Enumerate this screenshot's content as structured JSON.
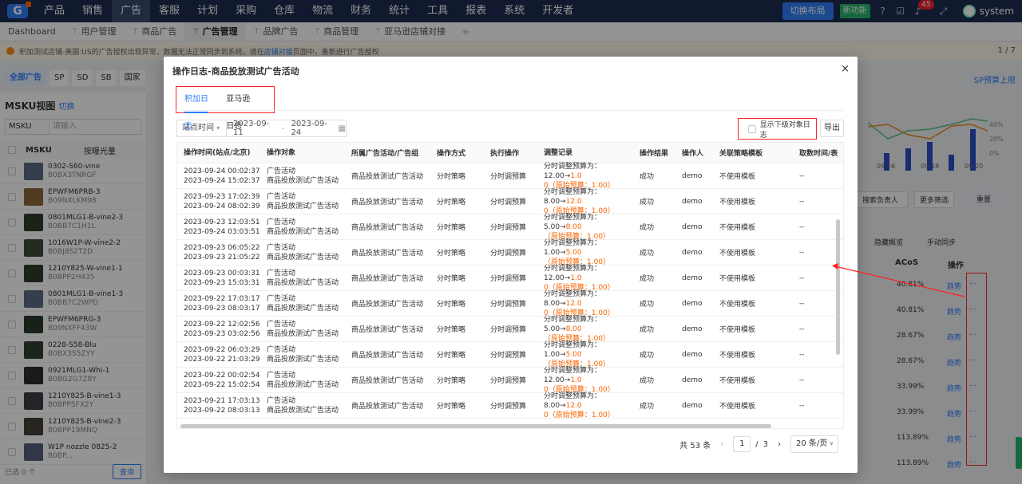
{
  "topnav": {
    "logo": "G",
    "menu": [
      "产品",
      "销售",
      "广告",
      "客服",
      "计划",
      "采购",
      "仓库",
      "物流",
      "财务",
      "统计",
      "工具",
      "报表",
      "系统",
      "开发者"
    ],
    "active_menu": "广告",
    "layout_btn": "切换布局",
    "new_feature": "新功能",
    "badge_count": "45",
    "user": "system"
  },
  "tabs": [
    {
      "label": "Dashboard",
      "pin": false,
      "active": false
    },
    {
      "label": "用户管理",
      "pin": true,
      "active": false
    },
    {
      "label": "商品广告",
      "pin": true,
      "active": false
    },
    {
      "label": "广告管理",
      "pin": true,
      "active": true
    },
    {
      "label": "品牌广告",
      "pin": true,
      "active": false
    },
    {
      "label": "商品管理",
      "pin": true,
      "active": false
    },
    {
      "label": "亚马逊店铺对接",
      "pin": true,
      "active": false
    }
  ],
  "tab_plus": "+",
  "notice": {
    "text": "积加测试店铺-美国:US的广告授权出现异常，数据无法正常同步到系统，请在",
    "link": "店铺对接",
    "tail": "页面中，重新进行广告授权"
  },
  "page_indicator": "1 / 7",
  "filters": [
    "全部广告",
    "SP",
    "SD",
    "SB",
    "国家"
  ],
  "sp_budget": "SP预算上限",
  "left_panel": {
    "title": "MSKU视图",
    "switch": "切换",
    "search_select": "MSKU",
    "search_placeholder": "请输入",
    "col_msku": "MSKU",
    "col_sort": "按曝光量",
    "items": [
      {
        "sku": "0302-S60-vine",
        "asin": "B0BX3TNRGF"
      },
      {
        "sku": "EPWFM6PRB-3",
        "asin": "B09NXLKM98"
      },
      {
        "sku": "0801MLG1-B-vine2-3",
        "asin": "B0BB7C1H1L"
      },
      {
        "sku": "1016W1P-W-vine2-2",
        "asin": "B0BJ8S2T2D"
      },
      {
        "sku": "1210Y825-W-vine1-1",
        "asin": "B0BPP2H435"
      },
      {
        "sku": "0801MLG1-B-vine1-3",
        "asin": "B0BB7C2WPD"
      },
      {
        "sku": "EPWFM6PRG-3",
        "asin": "B09NXFF43W"
      },
      {
        "sku": "0228-S58-Blu",
        "asin": "B0BX3S5ZYY"
      },
      {
        "sku": "0921MLG1-Whi-1",
        "asin": "B0BG2G7Z8Y"
      },
      {
        "sku": "1210Y825-B-vine1-3",
        "asin": "B0BPP5FX2Y"
      },
      {
        "sku": "1210Y825-B-vine2-3",
        "asin": "B0BPP19MNQ"
      },
      {
        "sku": "W1P nozzle 0825-2",
        "asin": "B0BP..."
      }
    ],
    "selected": "已选 0 个",
    "query_btn": "查询"
  },
  "right_bg": {
    "axis": [
      "40%",
      "20%",
      "0%"
    ],
    "xlabels": [
      "09-16",
      "09-18",
      "09-20"
    ],
    "filter_label": "搜索负责人",
    "more_filter": "更多筛选",
    "reset": "重置",
    "hide_overview": "隐藏概览",
    "manual_sync": "手动同步",
    "col_acos": "ACoS",
    "col_op": "操作",
    "rows": [
      {
        "acos": "40.81%",
        "trend": "趋势"
      },
      {
        "acos": "40.81%",
        "trend": "趋势"
      },
      {
        "acos": "28.67%",
        "trend": "趋势"
      },
      {
        "acos": "28.67%",
        "trend": "趋势"
      },
      {
        "acos": "33.99%",
        "trend": "趋势"
      },
      {
        "acos": "33.99%",
        "trend": "趋势"
      },
      {
        "acos": "113.89%",
        "trend": "趋势"
      },
      {
        "acos": "113.89%",
        "trend": "趋势"
      }
    ]
  },
  "modal": {
    "title": "操作日志-商品投放测试广告活动",
    "close": "×",
    "tabs": [
      "积加日志",
      "亚马逊日志"
    ],
    "active_tab": "积加日志",
    "date_type": "站点时间",
    "date_start": "2023-09-11",
    "date_sep": "-",
    "date_end": "2023-09-24",
    "show_sub_log": "显示下级对象日志",
    "export": "导出",
    "columns": [
      "操作时间(站点/北京)",
      "操作对象",
      "所属广告活动/广告组",
      "操作方式",
      "执行操作",
      "调整记录",
      "操作结果",
      "操作人",
      "关联策略模板",
      "取数时间/表"
    ],
    "rows": [
      {
        "t1": "2023-09-24 00:02:37",
        "t2": "2023-09-24 15:02:37",
        "obj1": "广告活动",
        "obj2": "商品投放测试广告活动",
        "camp": "商品投放测试广告活动",
        "method": "分时策略",
        "action": "分时调预算",
        "adj1": "分时调整预算为：12.00→",
        "adj1o": "1.0",
        "adj2": "0（原始预算：1.00）",
        "result": "成功",
        "user": "demo",
        "tpl": "不使用模板",
        "fetch": "--"
      },
      {
        "t1": "2023-09-23 17:02:39",
        "t2": "2023-09-24 08:02:39",
        "obj1": "广告活动",
        "obj2": "商品投放测试广告活动",
        "camp": "商品投放测试广告活动",
        "method": "分时策略",
        "action": "分时调预算",
        "adj1": "分时调整预算为：8.00→",
        "adj1o": "12.0",
        "adj2": "0（原始预算：1.00）",
        "result": "成功",
        "user": "demo",
        "tpl": "不使用模板",
        "fetch": "--"
      },
      {
        "t1": "2023-09-23 12:03:51",
        "t2": "2023-09-24 03:03:51",
        "obj1": "广告活动",
        "obj2": "商品投放测试广告活动",
        "camp": "商品投放测试广告活动",
        "method": "分时策略",
        "action": "分时调预算",
        "adj1": "分时调整预算为：5.00→",
        "adj1o": "8.00",
        "adj2": "（原始预算：1.00）",
        "result": "成功",
        "user": "demo",
        "tpl": "不使用模板",
        "fetch": "--"
      },
      {
        "t1": "2023-09-23 06:05:22",
        "t2": "2023-09-23 21:05:22",
        "obj1": "广告活动",
        "obj2": "商品投放测试广告活动",
        "camp": "商品投放测试广告活动",
        "method": "分时策略",
        "action": "分时调预算",
        "adj1": "分时调整预算为：1.00→",
        "adj1o": "5.00",
        "adj2": "（原始预算：1.00）",
        "result": "成功",
        "user": "demo",
        "tpl": "不使用模板",
        "fetch": "--"
      },
      {
        "t1": "2023-09-23 00:03:31",
        "t2": "2023-09-23 15:03:31",
        "obj1": "广告活动",
        "obj2": "商品投放测试广告活动",
        "camp": "商品投放测试广告活动",
        "method": "分时策略",
        "action": "分时调预算",
        "adj1": "分时调整预算为：12.00→",
        "adj1o": "1.0",
        "adj2": "0（原始预算：1.00）",
        "result": "成功",
        "user": "demo",
        "tpl": "不使用模板",
        "fetch": "--"
      },
      {
        "t1": "2023-09-22 17:03:17",
        "t2": "2023-09-23 08:03:17",
        "obj1": "广告活动",
        "obj2": "商品投放测试广告活动",
        "camp": "商品投放测试广告活动",
        "method": "分时策略",
        "action": "分时调预算",
        "adj1": "分时调整预算为：8.00→",
        "adj1o": "12.0",
        "adj2": "0（原始预算：1.00）",
        "result": "成功",
        "user": "demo",
        "tpl": "不使用模板",
        "fetch": "--"
      },
      {
        "t1": "2023-09-22 12:02:56",
        "t2": "2023-09-23 03:02:56",
        "obj1": "广告活动",
        "obj2": "商品投放测试广告活动",
        "camp": "商品投放测试广告活动",
        "method": "分时策略",
        "action": "分时调预算",
        "adj1": "分时调整预算为：5.00→",
        "adj1o": "8.00",
        "adj2": "（原始预算：1.00）",
        "result": "成功",
        "user": "demo",
        "tpl": "不使用模板",
        "fetch": "--"
      },
      {
        "t1": "2023-09-22 06:03:29",
        "t2": "2023-09-22 21:03:29",
        "obj1": "广告活动",
        "obj2": "商品投放测试广告活动",
        "camp": "商品投放测试广告活动",
        "method": "分时策略",
        "action": "分时调预算",
        "adj1": "分时调整预算为：1.00→",
        "adj1o": "5.00",
        "adj2": "（原始预算：1.00）",
        "result": "成功",
        "user": "demo",
        "tpl": "不使用模板",
        "fetch": "--"
      },
      {
        "t1": "2023-09-22 00:02:54",
        "t2": "2023-09-22 15:02:54",
        "obj1": "广告活动",
        "obj2": "商品投放测试广告活动",
        "camp": "商品投放测试广告活动",
        "method": "分时策略",
        "action": "分时调预算",
        "adj1": "分时调整预算为：12.00→",
        "adj1o": "1.0",
        "adj2": "0（原始预算：1.00）",
        "result": "成功",
        "user": "demo",
        "tpl": "不使用模板",
        "fetch": "--"
      },
      {
        "t1": "2023-09-21 17:03:13",
        "t2": "2023-09-22 08:03:13",
        "obj1": "广告活动",
        "obj2": "商品投放测试广告活动",
        "camp": "商品投放测试广告活动",
        "method": "分时策略",
        "action": "分时调预算",
        "adj1": "分时调整预算为：8.00→",
        "adj1o": "12.0",
        "adj2": "0（原始预算：1.00）",
        "result": "成功",
        "user": "demo",
        "tpl": "不使用模板",
        "fetch": "--"
      }
    ],
    "total": "共 53 条",
    "current_page": "1",
    "page_sep": "/",
    "total_pages": "3",
    "page_size": "20 条/页"
  },
  "colors": {
    "primary": "#2d7ff9",
    "nav": "#1d2b4e",
    "annotation": "#ff2222",
    "orange": "#fa6400"
  }
}
